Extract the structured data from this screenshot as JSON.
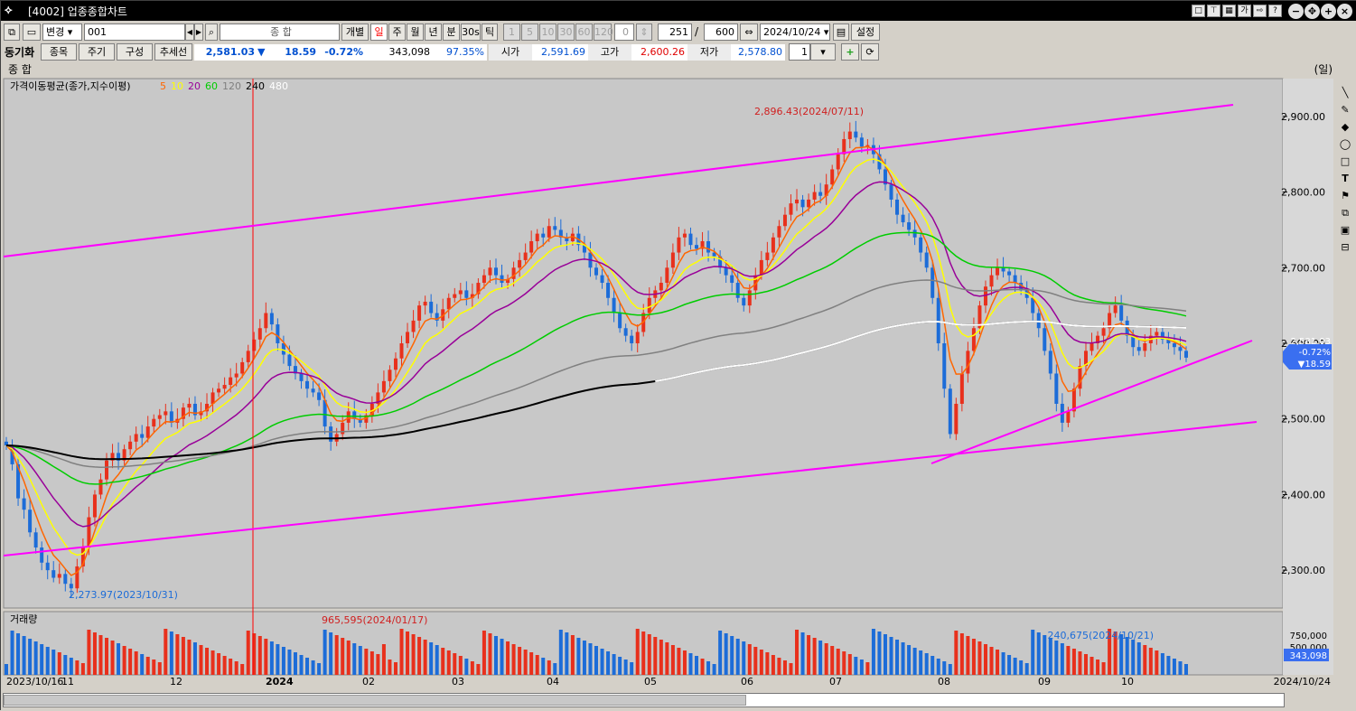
{
  "window": {
    "title": "[4002] 업종종합차트"
  },
  "toolbar": {
    "change_label": "변경",
    "code": "001",
    "name": "종 합",
    "indiv_label": "개별",
    "periods": [
      "일",
      "주",
      "월",
      "년",
      "분",
      "30s",
      "틱"
    ],
    "active_period": "일",
    "minute_steps": [
      "1",
      "5",
      "10",
      "30",
      "60",
      "120"
    ],
    "tick_value": "0",
    "count": "251",
    "total": "600",
    "date": "2024/10/24",
    "settings_label": "설정"
  },
  "quote": {
    "sync_label": "동기화",
    "item_btn": "종목",
    "cycle_btn": "주기",
    "compose_btn": "구성",
    "trend_btn": "추세선",
    "price": "2,581.03",
    "arrow": "▼",
    "change": "18.59",
    "change_pct": "-0.72%",
    "volume": "343,098",
    "ratio": "97.35%",
    "open_label": "시가",
    "open": "2,591.69",
    "high_label": "고가",
    "high": "2,600.26",
    "low_label": "저가",
    "low": "2,578.80",
    "spin": "1"
  },
  "chart_header": {
    "name": "종 합",
    "unit": "(일)"
  },
  "ma_legend": {
    "title": "가격이동평균(종가,지수이평)",
    "periods": [
      "5",
      "10",
      "20",
      "60",
      "120",
      "240",
      "480"
    ],
    "colors": [
      "#ff6600",
      "#ffff00",
      "#990099",
      "#00cc00",
      "#808080",
      "#000000",
      "#ffffff"
    ]
  },
  "annotations": {
    "high": "2,896.43(2024/07/11)",
    "low": "2,273.97(2023/10/31)",
    "vol_high": "965,595(2024/01/17)",
    "vol_last": "240,675(2024/10/21)"
  },
  "volume_panel": {
    "title": "거래량",
    "ticks": [
      "750,000",
      "500,000"
    ],
    "last": "343,098"
  },
  "price_axis": {
    "ticks": [
      "2,900.00",
      "2,800.00",
      "2,700.00",
      "2,600.00",
      "2,500.00",
      "2,400.00",
      "2,300.00"
    ],
    "tag_price": "2,581.03",
    "tag_pct": "-0.72%",
    "tag_chg": "▼18.59"
  },
  "time_axis": {
    "labels": [
      "2023/10/16",
      "11",
      "12",
      "2024",
      "02",
      "03",
      "04",
      "05",
      "06",
      "07",
      "08",
      "09",
      "10"
    ],
    "end": "2024/10/24"
  },
  "colors": {
    "up": "#e8301c",
    "down": "#1c6cd8",
    "bg": "#c8c8c8",
    "trend": "#ff00ff"
  },
  "chart_data": {
    "type": "candlestick",
    "ylim": [
      2250,
      2950
    ],
    "series": [
      {
        "name": "종합",
        "values": [
          2465,
          2440,
          2395,
          2380,
          2350,
          2330,
          2310,
          2300,
          2290,
          2295,
          2282,
          2276,
          2305,
          2330,
          2370,
          2400,
          2420,
          2445,
          2455,
          2445,
          2460,
          2470,
          2480,
          2475,
          2490,
          2500,
          2505,
          2510,
          2495,
          2500,
          2515,
          2520,
          2505,
          2510,
          2520,
          2535,
          2540,
          2545,
          2555,
          2560,
          2575,
          2590,
          2605,
          2620,
          2640,
          2625,
          2600,
          2585,
          2570,
          2560,
          2550,
          2540,
          2535,
          2525,
          2490,
          2470,
          2480,
          2495,
          2510,
          2500,
          2495,
          2505,
          2520,
          2535,
          2550,
          2565,
          2580,
          2600,
          2615,
          2630,
          2650,
          2655,
          2640,
          2630,
          2645,
          2660,
          2665,
          2670,
          2660,
          2665,
          2680,
          2690,
          2700,
          2690,
          2680,
          2685,
          2700,
          2710,
          2720,
          2735,
          2745,
          2740,
          2755,
          2750,
          2740,
          2735,
          2745,
          2730,
          2720,
          2700,
          2690,
          2680,
          2660,
          2640,
          2620,
          2610,
          2600,
          2615,
          2640,
          2660,
          2670,
          2680,
          2700,
          2720,
          2740,
          2745,
          2730,
          2725,
          2735,
          2720,
          2715,
          2700,
          2690,
          2680,
          2660,
          2650,
          2670,
          2690,
          2710,
          2720,
          2740,
          2755,
          2770,
          2785,
          2790,
          2780,
          2790,
          2800,
          2795,
          2810,
          2830,
          2850,
          2870,
          2880,
          2872,
          2860,
          2862,
          2850,
          2830,
          2810,
          2790,
          2770,
          2760,
          2750,
          2740,
          2720,
          2700,
          2660,
          2600,
          2540,
          2480,
          2520,
          2560,
          2590,
          2620,
          2650,
          2675,
          2690,
          2700,
          2695,
          2690,
          2680,
          2670,
          2660,
          2640,
          2620,
          2590,
          2560,
          2520,
          2495,
          2510,
          2540,
          2570,
          2590,
          2600,
          2610,
          2620,
          2640,
          2650,
          2630,
          2610,
          2595,
          2590,
          2600,
          2610,
          2615,
          2605,
          2600,
          2595,
          2590,
          2581
        ]
      }
    ]
  }
}
